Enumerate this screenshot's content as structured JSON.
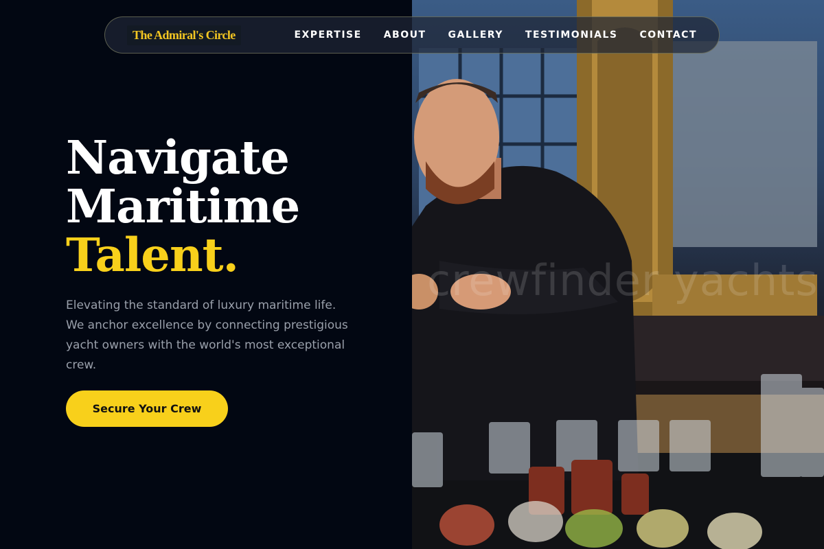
{
  "nav": {
    "logo": "The Admiral's Circle",
    "links": [
      "EXPERTISE",
      "ABOUT",
      "GALLERY",
      "TESTIMONIALS",
      "CONTACT"
    ]
  },
  "hero": {
    "line1": "Navigate",
    "line2": "Maritime",
    "line3": "Talent.",
    "subtitle": "Elevating the standard of luxury maritime life. We anchor excellence by connecting prestigious yacht owners with the world's most exceptional crew.",
    "cta": "Secure Your Crew"
  },
  "photo": {
    "watermark": "crewfinder yachts"
  },
  "colors": {
    "accent": "#f8d01b",
    "background": "#020712",
    "muted_text": "#9aa0ab"
  }
}
